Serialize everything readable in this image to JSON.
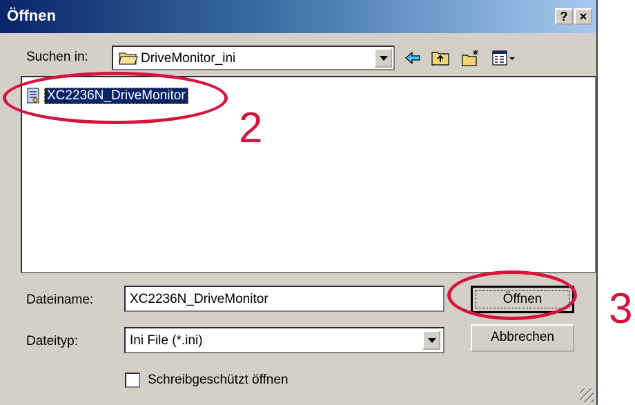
{
  "window": {
    "title": "Öffnen",
    "help_btn": "?",
    "close_btn": "×"
  },
  "lookin": {
    "label": "Suchen in:",
    "value": "DriveMonitor_ini"
  },
  "toolbar_icons": [
    "back-icon",
    "up-folder-icon",
    "new-folder-icon",
    "view-menu-icon"
  ],
  "files": [
    {
      "name": "XC2236N_DriveMonitor",
      "selected": true,
      "icon": "ini-file-icon"
    }
  ],
  "filename": {
    "label": "Dateiname:",
    "value": "XC2236N_DriveMonitor"
  },
  "filetype": {
    "label": "Dateityp:",
    "value": "Ini File (*.ini)"
  },
  "buttons": {
    "open": "Öffnen",
    "cancel": "Abbrechen"
  },
  "readonly": {
    "label": "Schreibgeschützt öffnen",
    "checked": false
  },
  "annotations": [
    "2",
    "3"
  ],
  "colors": {
    "title_start": "#0a246a",
    "title_end": "#a6caf0",
    "selection": "#0a246a",
    "annotation": "#d5143f"
  }
}
